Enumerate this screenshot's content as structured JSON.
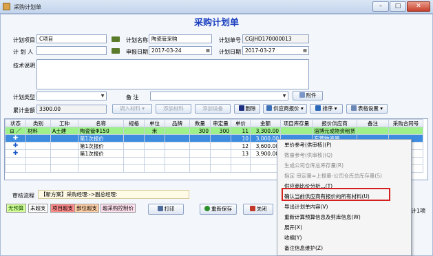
{
  "window": {
    "title": "采购计划单",
    "minimize": "–",
    "maximize": "□",
    "close": "✕"
  },
  "heading": "采购计划单",
  "form": {
    "project_label": "计划项目",
    "project_value": "C项目",
    "name_label": "计划名称",
    "name_value": "陶瓷管采购",
    "number_label": "计划单号",
    "number_value": "CGJHD170000013",
    "person_label": "计 划 人",
    "person_value": "",
    "apply_date_label": "申报日期",
    "apply_date_value": "2017-03-24",
    "plan_date_label": "计划日期",
    "plan_date_value": "2017-03-27",
    "tech_label": "技术说明",
    "tech_value": "",
    "type_label": "计划类型",
    "type_value": "",
    "remark_label": "备    注",
    "remark_value": "",
    "attach_label": "附件",
    "total_label": "累计金额",
    "total_value": "3300.00"
  },
  "toolbar": {
    "import": "调入材料 ▾",
    "add_material": "添加材料",
    "add_device": "添加设备",
    "delete": "删除",
    "supplier_quote": "供应商报价 ▾",
    "sort": "排序 ▾",
    "table_settings": "表格设置 ▾"
  },
  "grid": {
    "headers": [
      "状态",
      "类别",
      "工种",
      "名称",
      "规格",
      "单位",
      "品牌",
      "数量",
      "审定量",
      "单价",
      "金额",
      "项目库存量",
      "报价供应商",
      "备注",
      "采购合同号"
    ],
    "rows": [
      [
        "⊟ ／",
        "材料",
        "A土建",
        "陶瓷管Φ150",
        "",
        "米",
        "",
        "300",
        "300",
        "11",
        "3,300.00",
        "",
        "淄博元成物资租赁",
        "",
        ""
      ],
      [
        "✚",
        "",
        "",
        "第1次报价",
        "",
        "",
        "",
        "",
        "",
        "10",
        "3,000.00",
        "",
        "东营物资器",
        "",
        ""
      ],
      [
        "✚",
        "",
        "",
        "第1次报价",
        "",
        "",
        "",
        "",
        "",
        "12",
        "3,600.00",
        "",
        "",
        "",
        ""
      ],
      [
        "✚",
        "",
        "",
        "第1次报价",
        "",
        "",
        "",
        "",
        "",
        "13",
        "3,900.00",
        "",
        "",
        "",
        ""
      ]
    ]
  },
  "flow": {
    "label": "审核流程",
    "value": "【新方案】采购经理:->副总经理:"
  },
  "legend": [
    "无预算",
    "未超支",
    "项目超支",
    "部位超支",
    "超采购控制价"
  ],
  "actions": {
    "print": "打印",
    "resave": "重新保存",
    "close": "关闭",
    "count_right": "计1项"
  },
  "context_menu": [
    {
      "label": "单价参考(供审核)(P)",
      "enabled": true
    },
    {
      "label": "数量参考(供审核)(Q)",
      "enabled": false
    },
    {
      "label": "生成公司仓库总库存量(R)",
      "enabled": false
    },
    {
      "label": "指定 审定量=上报量-公司仓库总库存量(S)",
      "enabled": false
    },
    {
      "label": "供应商比价分析...(T)",
      "enabled": true
    },
    {
      "label": "确认当前供应商有报价的所有材料(U)",
      "enabled": true
    },
    {
      "label": "导出计划单内容(V)",
      "enabled": true
    },
    {
      "label": "重新计算预算信息及剪库信息(W)",
      "enabled": true
    },
    {
      "label": "展开(X)",
      "enabled": true
    },
    {
      "label": "收缩(Y)",
      "enabled": true
    },
    {
      "label": "备注信息维护(Z)",
      "enabled": true
    }
  ],
  "colors": {
    "accent": "#1a3fc0",
    "green_row": "#9ef08a",
    "selected_row": "#3d8ce0",
    "highlight": "#d62020"
  }
}
